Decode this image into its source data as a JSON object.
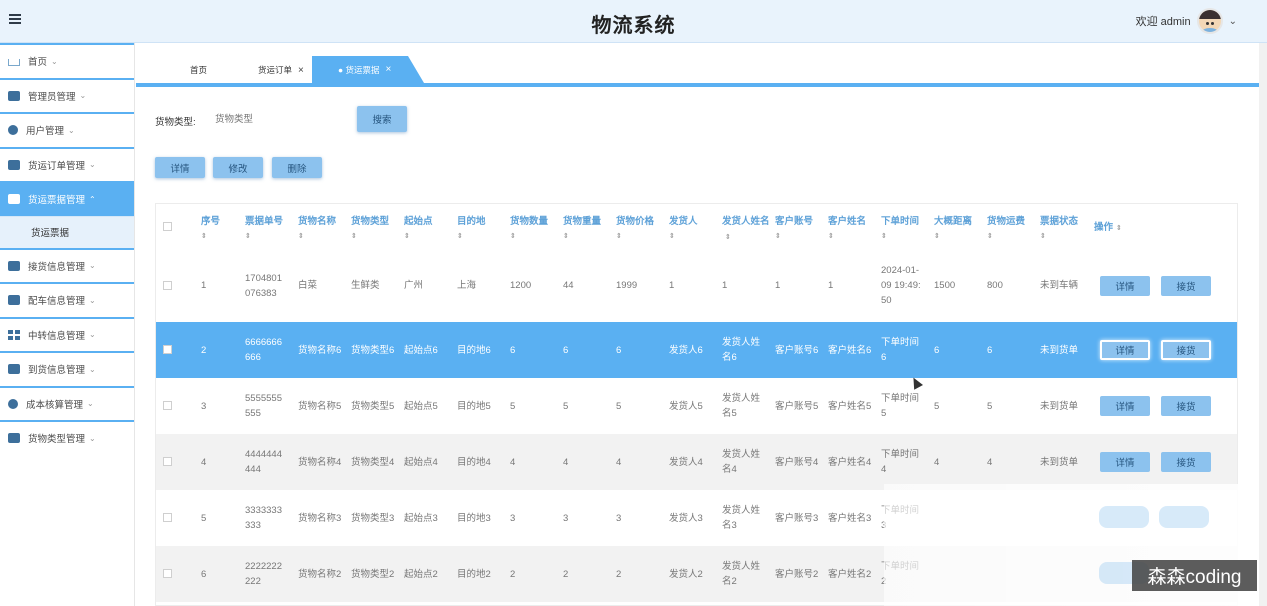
{
  "header": {
    "title": "物流系统",
    "welcome": "欢迎 admin"
  },
  "sidebar": {
    "items": [
      {
        "label": "首页",
        "icon": "home-icon"
      },
      {
        "label": "管理员管理",
        "icon": "admin-icon"
      },
      {
        "label": "用户管理",
        "icon": "user-icon"
      },
      {
        "label": "货运订单管理",
        "icon": "order-icon"
      },
      {
        "label": "货运票据管理",
        "icon": "receipt-icon",
        "active": true
      },
      {
        "label": "接货信息管理",
        "icon": "pickup-icon"
      },
      {
        "label": "配车信息管理",
        "icon": "vehicle-icon"
      },
      {
        "label": "中转信息管理",
        "icon": "transfer-icon"
      },
      {
        "label": "到货信息管理",
        "icon": "arrival-icon"
      },
      {
        "label": "成本核算管理",
        "icon": "cost-icon"
      },
      {
        "label": "货物类型管理",
        "icon": "cargo-type-icon"
      }
    ],
    "submenu": {
      "label": "货运票据"
    }
  },
  "tabs": [
    {
      "label": "首页"
    },
    {
      "label": "货运订单",
      "close": "×"
    },
    {
      "label": "● 货运票据",
      "close": "×"
    }
  ],
  "search": {
    "label": "货物类型:",
    "placeholder": "货物类型",
    "button": "搜索"
  },
  "actions": {
    "detail": "详情",
    "edit": "修改",
    "delete": "删除"
  },
  "table": {
    "headers": [
      "序号",
      "票据单号",
      "货物名称",
      "货物类型",
      "起始点",
      "目的地",
      "货物数量",
      "货物重量",
      "货物价格",
      "发货人",
      "发货人姓名",
      "客户账号",
      "客户姓名",
      "下单时间",
      "大概距离",
      "货物运费",
      "票据状态",
      "操作"
    ],
    "sort_glyph": "⇕",
    "rows": [
      {
        "no": "1",
        "bill": "1704801076383",
        "name": "白菜",
        "type": "生鲜类",
        "from": "广州",
        "to": "上海",
        "qty": "1200",
        "weight": "44",
        "price": "1999",
        "shipper": "1",
        "shipper_name": "1",
        "cust_acct": "1",
        "cust_name": "1",
        "time": "2024-01-09 19:49:50",
        "dist": "1500",
        "fee": "800",
        "status": "未到车辆"
      },
      {
        "no": "2",
        "bill": "6666666666",
        "name": "货物名称6",
        "type": "货物类型6",
        "from": "起始点6",
        "to": "目的地6",
        "qty": "6",
        "weight": "6",
        "price": "6",
        "shipper": "发货人6",
        "shipper_name": "发货人姓名6",
        "cust_acct": "客户账号6",
        "cust_name": "客户姓名6",
        "time": "下单时间6",
        "dist": "6",
        "fee": "6",
        "status": "未到货单"
      },
      {
        "no": "3",
        "bill": "5555555555",
        "name": "货物名称5",
        "type": "货物类型5",
        "from": "起始点5",
        "to": "目的地5",
        "qty": "5",
        "weight": "5",
        "price": "5",
        "shipper": "发货人5",
        "shipper_name": "发货人姓名5",
        "cust_acct": "客户账号5",
        "cust_name": "客户姓名5",
        "time": "下单时间5",
        "dist": "5",
        "fee": "5",
        "status": "未到货单"
      },
      {
        "no": "4",
        "bill": "4444444444",
        "name": "货物名称4",
        "type": "货物类型4",
        "from": "起始点4",
        "to": "目的地4",
        "qty": "4",
        "weight": "4",
        "price": "4",
        "shipper": "发货人4",
        "shipper_name": "发货人姓名4",
        "cust_acct": "客户账号4",
        "cust_name": "客户姓名4",
        "time": "下单时间4",
        "dist": "4",
        "fee": "4",
        "status": "未到货单"
      },
      {
        "no": "5",
        "bill": "3333333333",
        "name": "货物名称3",
        "type": "货物类型3",
        "from": "起始点3",
        "to": "目的地3",
        "qty": "3",
        "weight": "3",
        "price": "3",
        "shipper": "发货人3",
        "shipper_name": "发货人姓名3",
        "cust_acct": "客户账号3",
        "cust_name": "客户姓名3",
        "time": "下单时间3",
        "dist": "",
        "fee": "",
        "status": ""
      },
      {
        "no": "6",
        "bill": "2222222222",
        "name": "货物名称2",
        "type": "货物类型2",
        "from": "起始点2",
        "to": "目的地2",
        "qty": "2",
        "weight": "2",
        "price": "2",
        "shipper": "发货人2",
        "shipper_name": "发货人姓名2",
        "cust_acct": "客户账号2",
        "cust_name": "客户姓名2",
        "time": "下单时间2",
        "dist": "",
        "fee": "",
        "status": ""
      }
    ],
    "row_buttons": {
      "detail": "详情",
      "receive": "接货"
    }
  },
  "watermark": "森森coding"
}
